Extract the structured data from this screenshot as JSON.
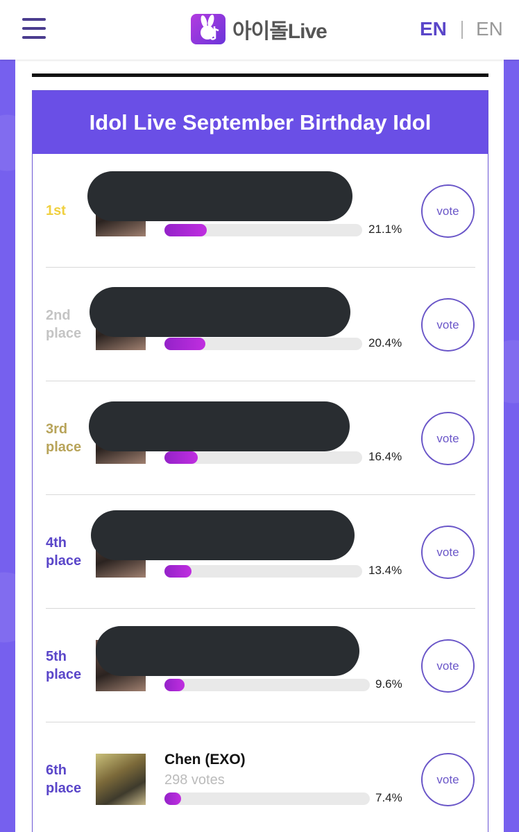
{
  "header": {
    "logo_text": "아이돌Live",
    "lang_active": "EN",
    "lang_other": "EN",
    "accent": "#6a4fe6"
  },
  "board": {
    "title": "Idol Live September Birthday Idol",
    "vote_label": "vote",
    "ranks": [
      {
        "rank_line1": "1st",
        "rank_line2": "",
        "rank_color": "#f0d040",
        "name": "",
        "votes": "",
        "percent_text": "21.1%",
        "percent": 21.1,
        "redacted": true
      },
      {
        "rank_line1": "2nd",
        "rank_line2": "place",
        "rank_color": "#c4c4c4",
        "name": "",
        "votes": "",
        "percent_text": "20.4%",
        "percent": 20.4,
        "redacted": true
      },
      {
        "rank_line1": "3rd",
        "rank_line2": "place",
        "rank_color": "#b8a45a",
        "name": "",
        "votes": "",
        "percent_text": "16.4%",
        "percent": 16.4,
        "redacted": true
      },
      {
        "rank_line1": "4th",
        "rank_line2": "place",
        "rank_color": "#5a46c9",
        "name": "",
        "votes": "",
        "percent_text": "13.4%",
        "percent": 13.4,
        "redacted": true
      },
      {
        "rank_line1": "5th",
        "rank_line2": "place",
        "rank_color": "#5a46c9",
        "name": "",
        "votes": "",
        "percent_text": "9.6%",
        "percent": 9.6,
        "redacted": true
      },
      {
        "rank_line1": "6th",
        "rank_line2": "place",
        "rank_color": "#5a46c9",
        "name": "Chen (EXO)",
        "votes": "298 votes",
        "percent_text": "7.4%",
        "percent": 7.4,
        "redacted": false
      }
    ]
  }
}
